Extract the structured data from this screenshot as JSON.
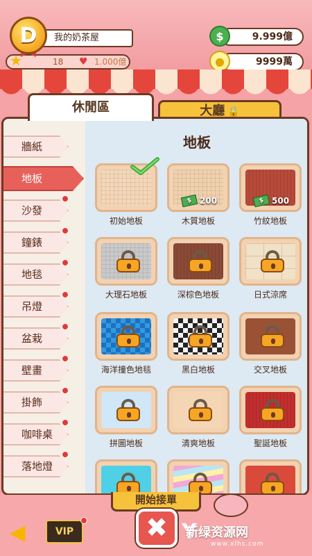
{
  "header": {
    "avatar_letter": "D",
    "shop_name": "我的奶茶屋",
    "level": "18",
    "level_money": "1.000億",
    "coins": "9.999億",
    "gems": "9999萬"
  },
  "tabs": [
    {
      "label": "休閒區"
    },
    {
      "label": "大廳"
    }
  ],
  "section_title": "地板",
  "sidebar": {
    "items": [
      {
        "label": "牆紙",
        "dot": false
      },
      {
        "label": "地板",
        "dot": false,
        "active": true
      },
      {
        "label": "沙發",
        "dot": true
      },
      {
        "label": "鐘錶",
        "dot": true
      },
      {
        "label": "地毯",
        "dot": true
      },
      {
        "label": "吊燈",
        "dot": true
      },
      {
        "label": "盆栽",
        "dot": true
      },
      {
        "label": "壁畫",
        "dot": true
      },
      {
        "label": "掛飾",
        "dot": true
      },
      {
        "label": "咖啡桌",
        "dot": true
      },
      {
        "label": "落地燈",
        "dot": true
      }
    ]
  },
  "floors": [
    {
      "name": "初始地板",
      "state": "owned",
      "pattern": "#f4d7b8"
    },
    {
      "name": "木質地板",
      "state": "price",
      "price": "200",
      "pattern": "#f1d0ad"
    },
    {
      "name": "竹紋地板",
      "state": "price",
      "price": "500",
      "pattern": "#b84a3a"
    },
    {
      "name": "大理石地板",
      "state": "locked",
      "pattern": "#c9c9c9"
    },
    {
      "name": "深棕色地板",
      "state": "locked",
      "pattern": "#8a4a36"
    },
    {
      "name": "日式涼席",
      "state": "locked",
      "pattern": "#f1e1c6"
    },
    {
      "name": "海洋撞色地毯",
      "state": "locked",
      "pattern": "#2f9be0"
    },
    {
      "name": "黑白地板",
      "state": "locked",
      "pattern": "#f2f2f2"
    },
    {
      "name": "交叉地板",
      "state": "locked",
      "pattern": "#9a5236"
    },
    {
      "name": "拼圖地板",
      "state": "locked",
      "pattern": "#cfe7f7"
    },
    {
      "name": "清爽地板",
      "state": "locked",
      "pattern": "#f4d6b5"
    },
    {
      "name": "聖誕地板",
      "state": "locked",
      "pattern": "#c22e2e"
    },
    {
      "name": "",
      "state": "locked",
      "pattern": "#4fd0e6"
    },
    {
      "name": "",
      "state": "locked",
      "pattern": "#f2a8d8"
    },
    {
      "name": "",
      "state": "locked",
      "pattern": "#d94a3a"
    }
  ],
  "bottom": {
    "start_label": "開始接單",
    "vip_label": "VIP",
    "close_symbol": "✖",
    "back_symbol": "◀"
  },
  "watermark": {
    "text": "新绿资源网",
    "sub": "www.xlhs.com"
  },
  "colors": {
    "accent": "#e7615a",
    "gold": "#f7c23b",
    "border": "#6b3a24"
  }
}
